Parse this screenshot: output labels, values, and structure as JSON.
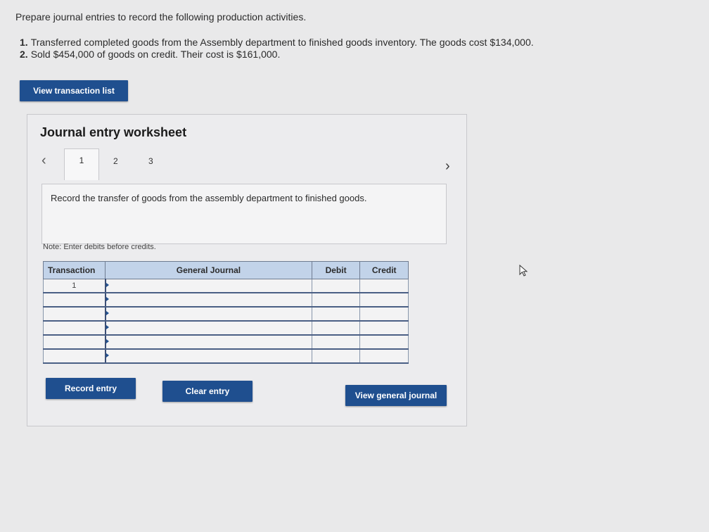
{
  "prompt": "Prepare journal entries to record the following production activities.",
  "activities": [
    {
      "num": "1.",
      "text": "Transferred completed goods from the Assembly department to finished goods inventory. The goods cost $134,000."
    },
    {
      "num": "2.",
      "text": "Sold $454,000 of goods on credit. Their cost is $161,000."
    }
  ],
  "view_transactions_label": "View transaction list",
  "worksheet": {
    "title": "Journal entry worksheet",
    "tabs": [
      "1",
      "2",
      "3"
    ],
    "instruction": "Record the transfer of goods from the assembly department to finished goods.",
    "note": "Note: Enter debits before credits.",
    "table": {
      "headers": [
        "Transaction",
        "General Journal",
        "Debit",
        "Credit"
      ],
      "rows": [
        {
          "transaction": "1",
          "account": "",
          "debit": "",
          "credit": ""
        },
        {
          "transaction": "",
          "account": "",
          "debit": "",
          "credit": ""
        },
        {
          "transaction": "",
          "account": "",
          "debit": "",
          "credit": ""
        },
        {
          "transaction": "",
          "account": "",
          "debit": "",
          "credit": ""
        },
        {
          "transaction": "",
          "account": "",
          "debit": "",
          "credit": ""
        },
        {
          "transaction": "",
          "account": "",
          "debit": "",
          "credit": ""
        }
      ]
    },
    "buttons": {
      "record": "Record entry",
      "clear": "Clear entry",
      "view_journal": "View general journal"
    }
  },
  "icons": {
    "prev": "chevron-left-icon",
    "next": "chevron-right-icon",
    "cursor": "mouse-pointer-icon"
  },
  "colors": {
    "button": "#1f4f8f",
    "header": "#c2d3e9"
  }
}
